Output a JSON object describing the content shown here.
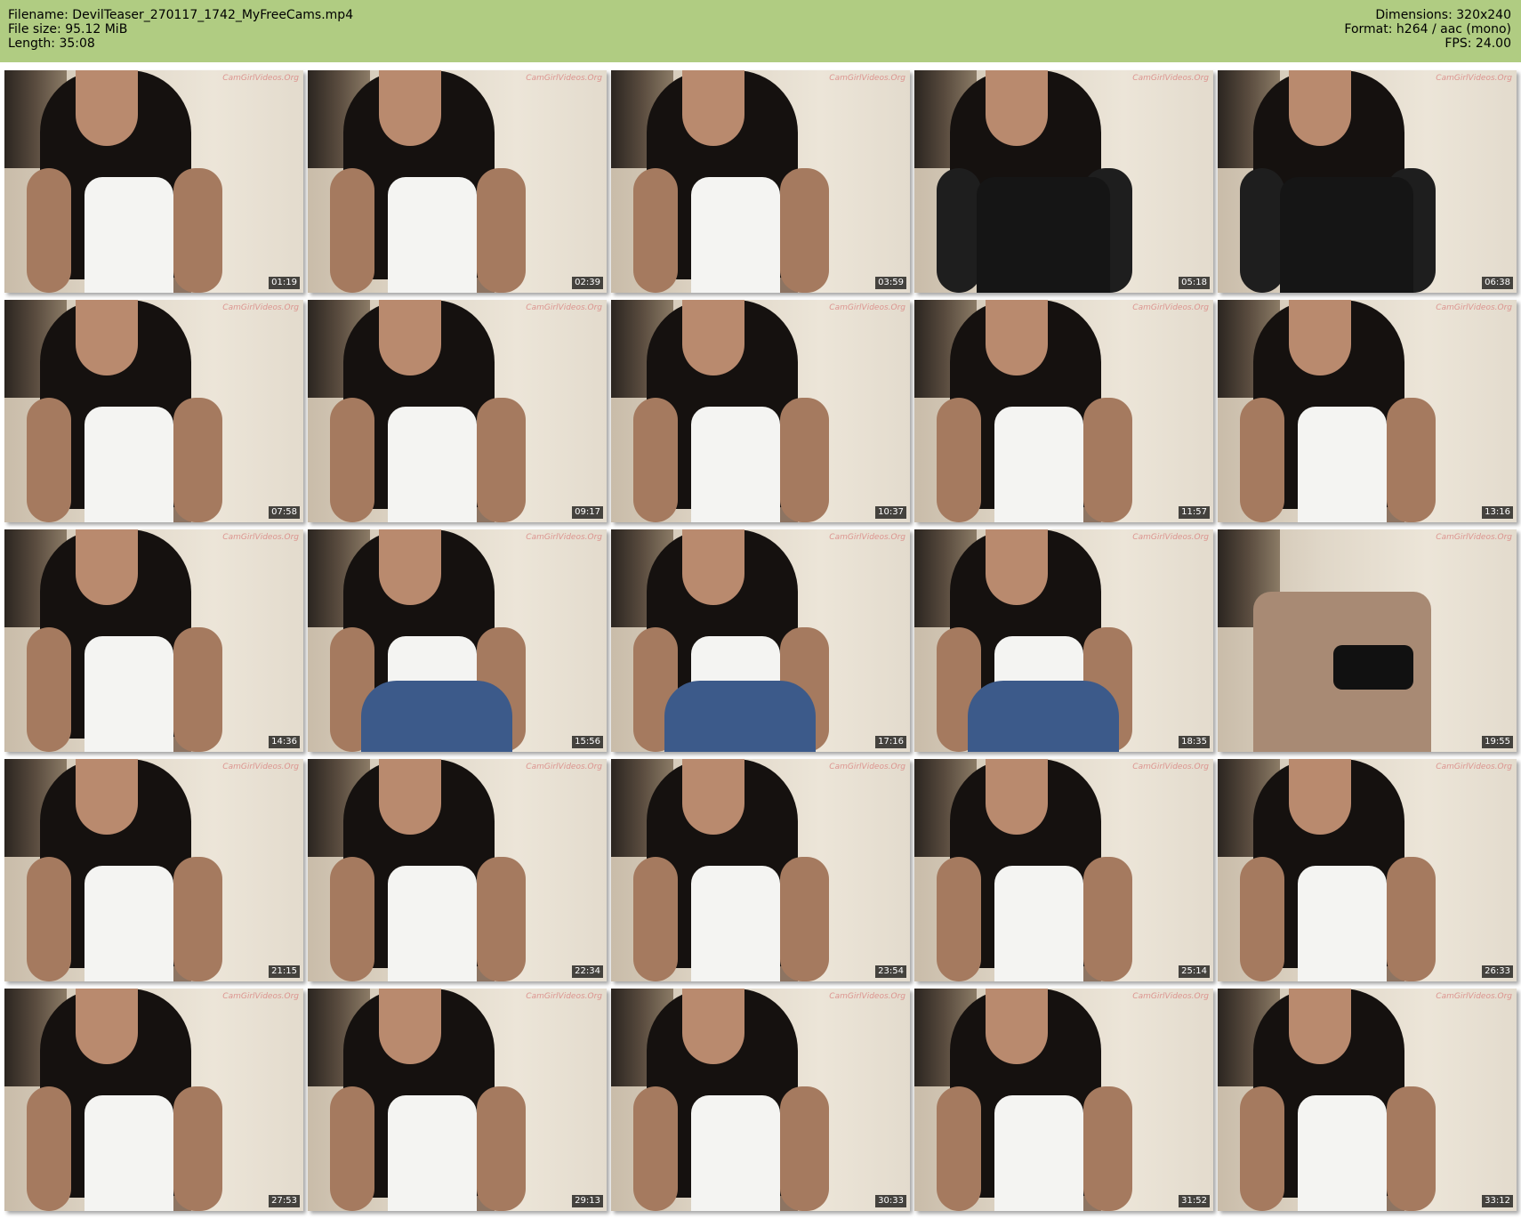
{
  "header": {
    "filename": "Filename: DevilTeaser_270117_1742_MyFreeCams.mp4",
    "filesize": "File size: 95.12 MiB",
    "length": "Length: 35:08",
    "dimensions": "Dimensions: 320x240",
    "format": "Format: h264 / aac (mono)",
    "fps": "FPS: 24.00"
  },
  "colors": {
    "header_bg": "#b0cc82",
    "timestamp_bg": "#000000",
    "timestamp_text": "#ffffff"
  },
  "thumbnails": [
    {
      "time": "01:19",
      "watermark": "CamGirlVideos.Org",
      "scene": "white-top"
    },
    {
      "time": "02:39",
      "watermark": "CamGirlVideos.Org",
      "scene": "white-top"
    },
    {
      "time": "03:59",
      "watermark": "CamGirlVideos.Org",
      "scene": "white-top"
    },
    {
      "time": "05:18",
      "watermark": "CamGirlVideos.Org",
      "scene": "jacket"
    },
    {
      "time": "06:38",
      "watermark": "CamGirlVideos.Org",
      "scene": "jacket"
    },
    {
      "time": "07:58",
      "watermark": "CamGirlVideos.Org",
      "scene": "white-top"
    },
    {
      "time": "09:17",
      "watermark": "CamGirlVideos.Org",
      "scene": "white-top"
    },
    {
      "time": "10:37",
      "watermark": "CamGirlVideos.Org",
      "scene": "white-top"
    },
    {
      "time": "11:57",
      "watermark": "CamGirlVideos.Org",
      "scene": "white-top"
    },
    {
      "time": "13:16",
      "watermark": "CamGirlVideos.Org",
      "scene": "white-top"
    },
    {
      "time": "14:36",
      "watermark": "CamGirlVideos.Org",
      "scene": "white-top"
    },
    {
      "time": "15:56",
      "watermark": "CamGirlVideos.Org",
      "scene": "jeans"
    },
    {
      "time": "17:16",
      "watermark": "CamGirlVideos.Org",
      "scene": "jeans"
    },
    {
      "time": "18:35",
      "watermark": "CamGirlVideos.Org",
      "scene": "jeans"
    },
    {
      "time": "19:55",
      "watermark": "CamGirlVideos.Org",
      "scene": "empty"
    },
    {
      "time": "21:15",
      "watermark": "CamGirlVideos.Org",
      "scene": "white-top"
    },
    {
      "time": "22:34",
      "watermark": "CamGirlVideos.Org",
      "scene": "white-top"
    },
    {
      "time": "23:54",
      "watermark": "CamGirlVideos.Org",
      "scene": "white-top"
    },
    {
      "time": "25:14",
      "watermark": "CamGirlVideos.Org",
      "scene": "white-top"
    },
    {
      "time": "26:33",
      "watermark": "CamGirlVideos.Org",
      "scene": "white-top"
    },
    {
      "time": "27:53",
      "watermark": "CamGirlVideos.Org",
      "scene": "white-top"
    },
    {
      "time": "29:13",
      "watermark": "CamGirlVideos.Org",
      "scene": "white-top"
    },
    {
      "time": "30:33",
      "watermark": "CamGirlVideos.Org",
      "scene": "white-top"
    },
    {
      "time": "31:52",
      "watermark": "CamGirlVideos.Org",
      "scene": "white-top"
    },
    {
      "time": "33:12",
      "watermark": "CamGirlVideos.Org",
      "scene": "white-top"
    }
  ]
}
